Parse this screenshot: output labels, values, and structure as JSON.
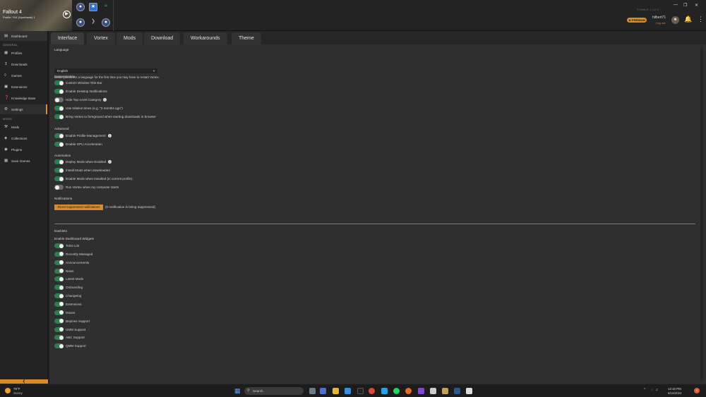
{
  "game": {
    "title": "Fallout 4",
    "profile": "Profile: Y04 (Hyrdhawk) 1"
  },
  "window": {
    "version": "STABLE 1.12.0"
  },
  "account": {
    "premium": "★ PREMIUM",
    "username": "hilbert71",
    "logout": "Log out"
  },
  "sidebar": {
    "dashboard": "Dashboard",
    "group_general": "GENERAL",
    "general": [
      "Profiles",
      "Downloads",
      "Games",
      "Extensions",
      "Knowledge Base",
      "Settings"
    ],
    "group_mods": "MODS",
    "mods": [
      "Mods",
      "Collections",
      "Plugins",
      "Save Games"
    ]
  },
  "tabs": [
    "Interface",
    "Vortex",
    "Mods",
    "Download",
    "Workarounds",
    "Theme"
  ],
  "interface": {
    "language_heading": "Language",
    "language_value": "English",
    "language_hint": "When you select a language for the first time you may have to restart Vortex.",
    "customisation_heading": "Customisation",
    "customisation": [
      {
        "label": "Custom Window Title Bar",
        "on": true
      },
      {
        "label": "Enable Desktop Notifications",
        "on": true
      },
      {
        "label": "Hide Top-Level Category",
        "on": false,
        "info": true
      },
      {
        "label": "Use relative times (e.g. \"3 months ago\")",
        "on": true
      },
      {
        "label": "Bring Vortex to foreground when starting downloads in browser",
        "on": true
      }
    ],
    "advanced_heading": "Advanced",
    "advanced": [
      {
        "label": "Enable Profile Management",
        "on": true,
        "info": true
      },
      {
        "label": "Enable GPU Acceleration",
        "on": true
      }
    ],
    "automation_heading": "Automation",
    "automation": [
      {
        "label": "Deploy Mods when Enabled",
        "on": true,
        "info": true
      },
      {
        "label": "Install Mods when downloaded",
        "on": true
      },
      {
        "label": "Enable Mods when installed (in current profile)",
        "on": true
      },
      {
        "label": "Run Vortex when my computer starts",
        "on": false
      }
    ],
    "notifications_heading": "Notifications",
    "reset_button": "Reset suppressed notifications",
    "reset_note": "(0 notification is being suppressed)",
    "dashlets_heading": "Dashlets",
    "widgets_heading": "Enable Dashboard Widgets",
    "widgets": [
      "ToDo List",
      "Recently Managed",
      "Announcements",
      "News",
      "Latest Mods",
      "Onboarding",
      "Changelog",
      "Extensions",
      "Issues",
      "Bepinex Support",
      "UMM Support",
      "ABC Support",
      "QMM Support"
    ]
  },
  "taskbar": {
    "weather_temp": "79°F",
    "weather_cond": "Sunny",
    "search": "Search",
    "time": "12:10 PM",
    "date": "6/16/2024"
  },
  "colors": {
    "accent": "#d98a2b",
    "toggle_on": "#2f7d4f",
    "toggle_off": "#6b6b6b"
  }
}
